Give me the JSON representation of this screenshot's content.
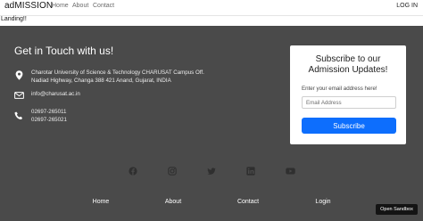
{
  "navbar": {
    "brand": "adMISSION",
    "links": [
      "Home",
      "About",
      "Contact"
    ],
    "login": "LOG IN"
  },
  "page": {
    "landing_text": "Landing!!"
  },
  "contact": {
    "title": "Get in Touch with us!",
    "address_line1": "Charotar University of Science & Technology CHARUSAT Campus Off.",
    "address_line2": "Nadiad Highway, Changa 388 421 Anand, Gujarat, INDIA",
    "email": "info@charusat.ac.in",
    "phone1": "02697-265011",
    "phone2": "02697-265021",
    "icons": [
      "location-pin-icon",
      "envelope-icon",
      "phone-icon"
    ]
  },
  "subscribe": {
    "title_line1": "Subscribe to our",
    "title_line2": "Admission Updates!",
    "label": "Enter your email address here!",
    "placeholder": "Email Address",
    "button": "Subscribe",
    "button_color": "#0d6efd"
  },
  "social": {
    "icons": [
      "facebook-icon",
      "instagram-icon",
      "twitter-icon",
      "linkedin-icon",
      "youtube-icon"
    ]
  },
  "footer": {
    "links": [
      "Home",
      "About",
      "Contact",
      "Login"
    ],
    "background": "#4a4a4a"
  },
  "sandbox": {
    "label": "Open Sandbox"
  }
}
